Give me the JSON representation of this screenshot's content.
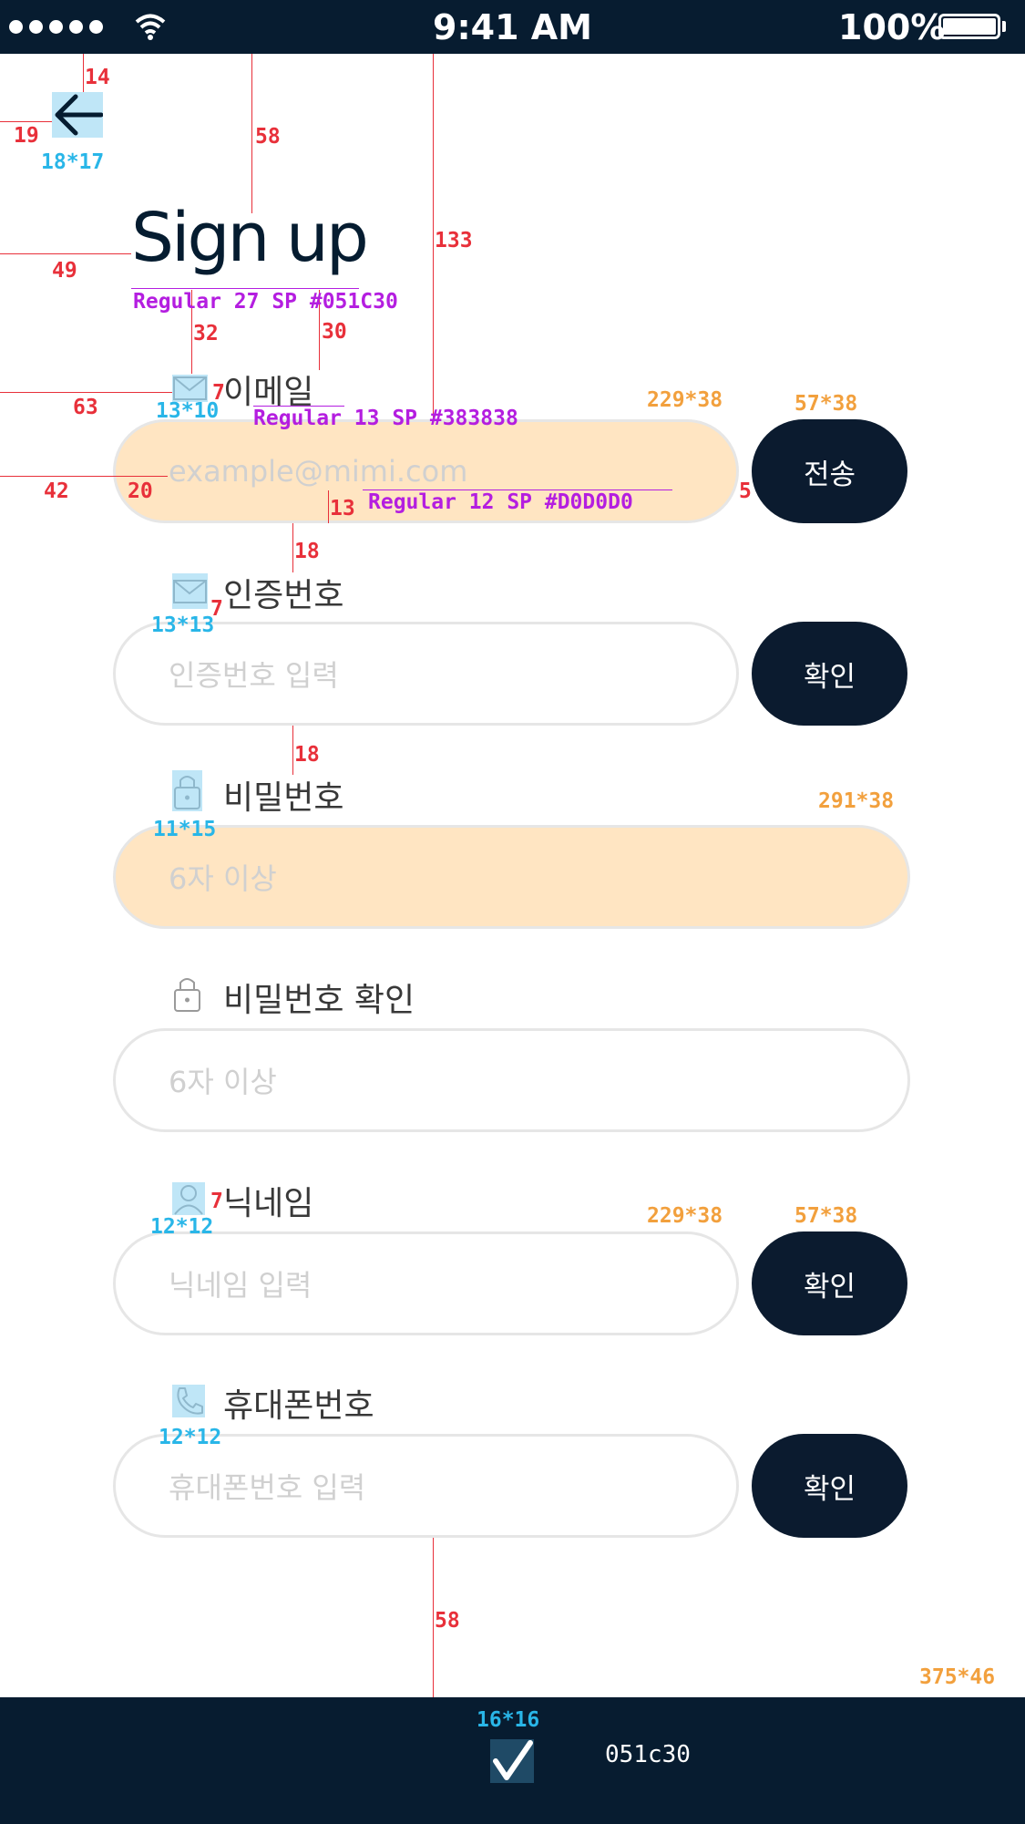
{
  "status_bar": {
    "time": "9:41 AM",
    "battery": "100%"
  },
  "page": {
    "title": "Sign up"
  },
  "form": {
    "email": {
      "label": "이메일",
      "placeholder": "example@mimi.com",
      "button": "전송"
    },
    "code": {
      "label": "인증번호",
      "placeholder": "인증번호 입력",
      "button": "확인"
    },
    "password": {
      "label": "비밀번호",
      "placeholder": "6자 이상"
    },
    "password_confirm": {
      "label": "비밀번호 확인",
      "placeholder": "6자 이상"
    },
    "nickname": {
      "label": "닉네임",
      "placeholder": "닉네임 입력",
      "button": "확인"
    },
    "phone": {
      "label": "휴대폰번호",
      "placeholder": "휴대폰번호 입력",
      "button": "확인"
    }
  },
  "bottom_bar": {
    "color_label": "051c30",
    "icon": "check-icon"
  },
  "colors": {
    "primary": "#051c30",
    "button": "#0b1b2f",
    "label": "#383838",
    "placeholder": "#d0d0d0"
  },
  "annotations": {
    "spacing": [
      "14",
      "19",
      "58",
      "133",
      "49",
      "32",
      "30",
      "7",
      "63",
      "42",
      "20",
      "13",
      "5",
      "18",
      "7",
      "18",
      "7",
      "58"
    ],
    "sizes_blue": [
      "18*17",
      "13*10",
      "13*13",
      "11*15",
      "12*12",
      "12*12",
      "16*16"
    ],
    "sizes_orange": [
      "229*38",
      "57*38",
      "291*38",
      "229*38",
      "57*38",
      "375*46"
    ],
    "typography": [
      "Regular 27 SP #051C30",
      "Regular 13 SP #383838",
      "Regular 12 SP #D0D0D0"
    ]
  }
}
